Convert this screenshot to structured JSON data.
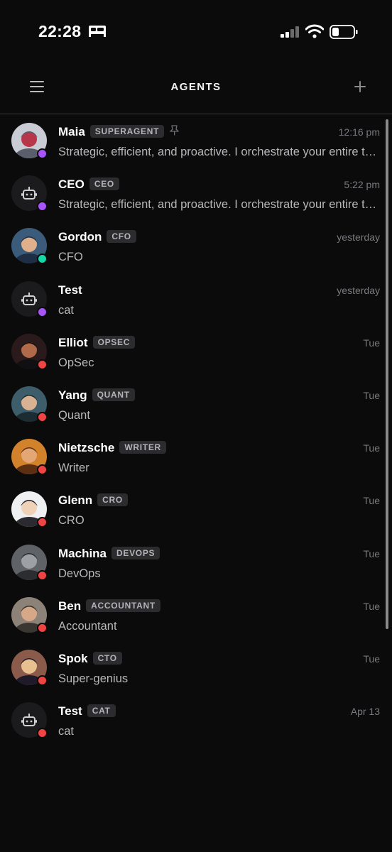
{
  "status_bar": {
    "time": "22:28"
  },
  "header": {
    "title": "AGENTS"
  },
  "colors": {
    "online": "#a855f7",
    "active": "#14d8a8",
    "offline": "#ef4444"
  },
  "agents": [
    {
      "name": "Maia",
      "badge": "SUPERAGENT",
      "pinned": true,
      "time": "12:16 pm",
      "preview": "Strategic, efficient, and proactive. I orchestrate your entire team",
      "avatar": "robot-portrait-avatar",
      "status": "online"
    },
    {
      "name": "CEO",
      "badge": "CEO",
      "pinned": false,
      "time": "5:22 pm",
      "preview": "Strategic, efficient, and proactive. I orchestrate your entire team",
      "avatar": "bot-icon",
      "status": "online"
    },
    {
      "name": "Gordon",
      "badge": "CFO",
      "pinned": false,
      "time": "yesterday",
      "preview": "CFO",
      "avatar": "man-suit-avatar",
      "status": "active"
    },
    {
      "name": "Test",
      "badge": "",
      "pinned": false,
      "time": "yesterday",
      "preview": "cat",
      "avatar": "bot-icon",
      "status": "online"
    },
    {
      "name": "Elliot",
      "badge": "OPSEC",
      "pinned": false,
      "time": "Tue",
      "preview": "OpSec",
      "avatar": "hooded-man-avatar",
      "status": "offline"
    },
    {
      "name": "Yang",
      "badge": "QUANT",
      "pinned": false,
      "time": "Tue",
      "preview": "Quant",
      "avatar": "man-glasses-avatar",
      "status": "offline"
    },
    {
      "name": "Nietzsche",
      "badge": "WRITER",
      "pinned": false,
      "time": "Tue",
      "preview": "Writer",
      "avatar": "mustache-man-avatar",
      "status": "offline"
    },
    {
      "name": "Glenn",
      "badge": "CRO",
      "pinned": false,
      "time": "Tue",
      "preview": "CRO",
      "avatar": "anime-man-avatar",
      "status": "offline"
    },
    {
      "name": "Machina",
      "badge": "DEVOPS",
      "pinned": false,
      "time": "Tue",
      "preview": "DevOps",
      "avatar": "android-face-avatar",
      "status": "offline"
    },
    {
      "name": "Ben",
      "badge": "ACCOUNTANT",
      "pinned": false,
      "time": "Tue",
      "preview": "Accountant",
      "avatar": "office-man-avatar",
      "status": "offline"
    },
    {
      "name": "Spok",
      "badge": "CTO",
      "pinned": false,
      "time": "Tue",
      "preview": "Super-genius",
      "avatar": "vulcan-avatar",
      "status": "offline"
    },
    {
      "name": "Test",
      "badge": "CAT",
      "pinned": false,
      "time": "Apr 13",
      "preview": "cat",
      "avatar": "bot-icon",
      "status": "offline"
    }
  ]
}
